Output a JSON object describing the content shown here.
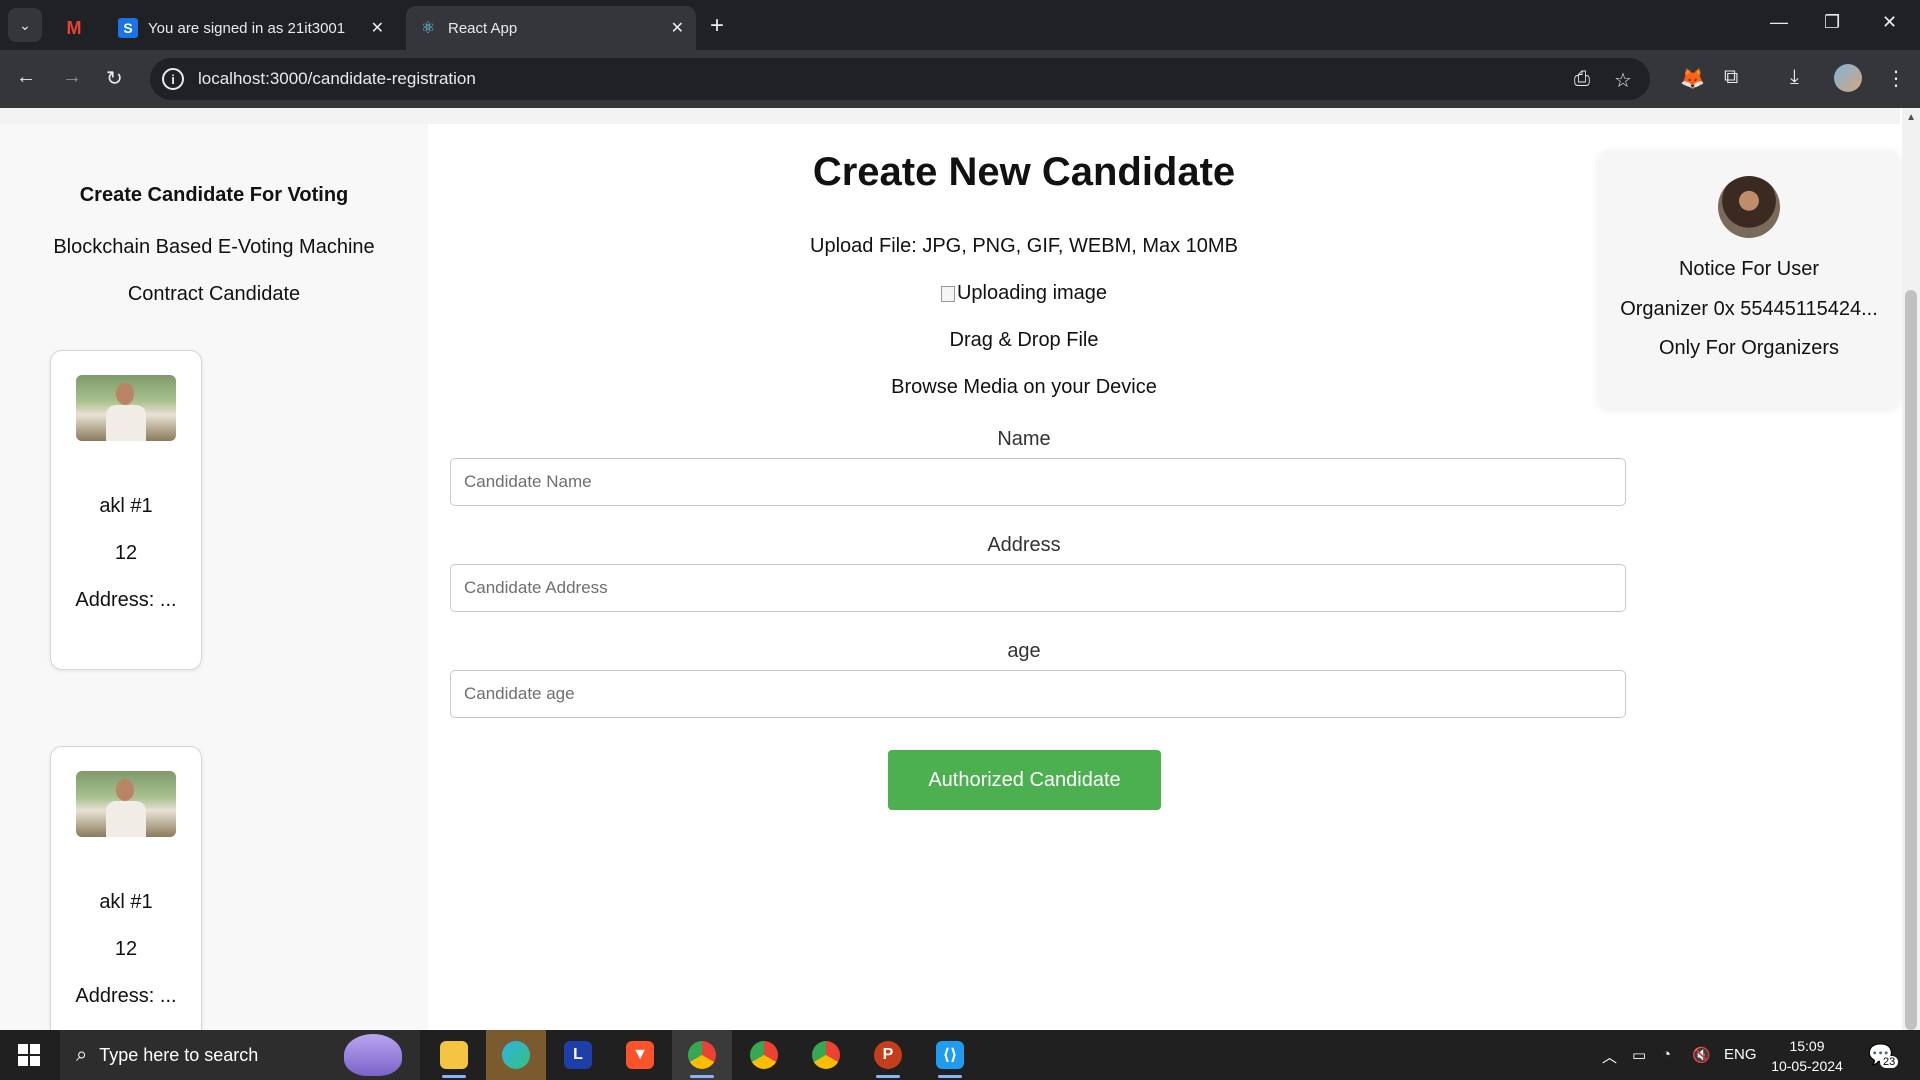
{
  "browser": {
    "tabs": [
      {
        "title": "",
        "icon": "gmail-icon"
      },
      {
        "title": "You are signed in as 21it3001",
        "icon": "s-icon"
      },
      {
        "title": "React App",
        "icon": "react-icon"
      }
    ],
    "url": "localhost:3000/candidate-registration"
  },
  "sidebar": {
    "title": "Create Candidate For Voting",
    "subtitle": "Blockchain Based E-Voting Machine",
    "section": "Contract Candidate",
    "candidates": [
      {
        "name": "akl #1",
        "age": "12",
        "address": "Address: ..."
      },
      {
        "name": "akl #1",
        "age": "12",
        "address": "Address: ..."
      }
    ]
  },
  "main": {
    "title": "Create New Candidate",
    "upload_info": "Upload File: JPG, PNG, GIF, WEBM, Max 10MB",
    "image_alt": "Uploading image",
    "drag_drop": "Drag & Drop File",
    "browse": "Browse Media on your Device",
    "fields": {
      "name": {
        "label": "Name",
        "placeholder": "Candidate Name"
      },
      "address": {
        "label": "Address",
        "placeholder": "Candidate Address"
      },
      "age": {
        "label": "age",
        "placeholder": "Candidate age"
      }
    },
    "submit_label": "Authorized Candidate"
  },
  "notice": {
    "title": "Notice For User",
    "organizer": "Organizer 0x 55445115424...",
    "restriction": "Only For Organizers"
  },
  "taskbar": {
    "search_placeholder": "Type here to search",
    "language": "ENG",
    "time": "15:09",
    "date": "10-05-2024",
    "notification_count": "23"
  },
  "colors": {
    "accent_green": "#4caf50",
    "chrome_dark": "#202124",
    "toolbar": "#35363a"
  }
}
